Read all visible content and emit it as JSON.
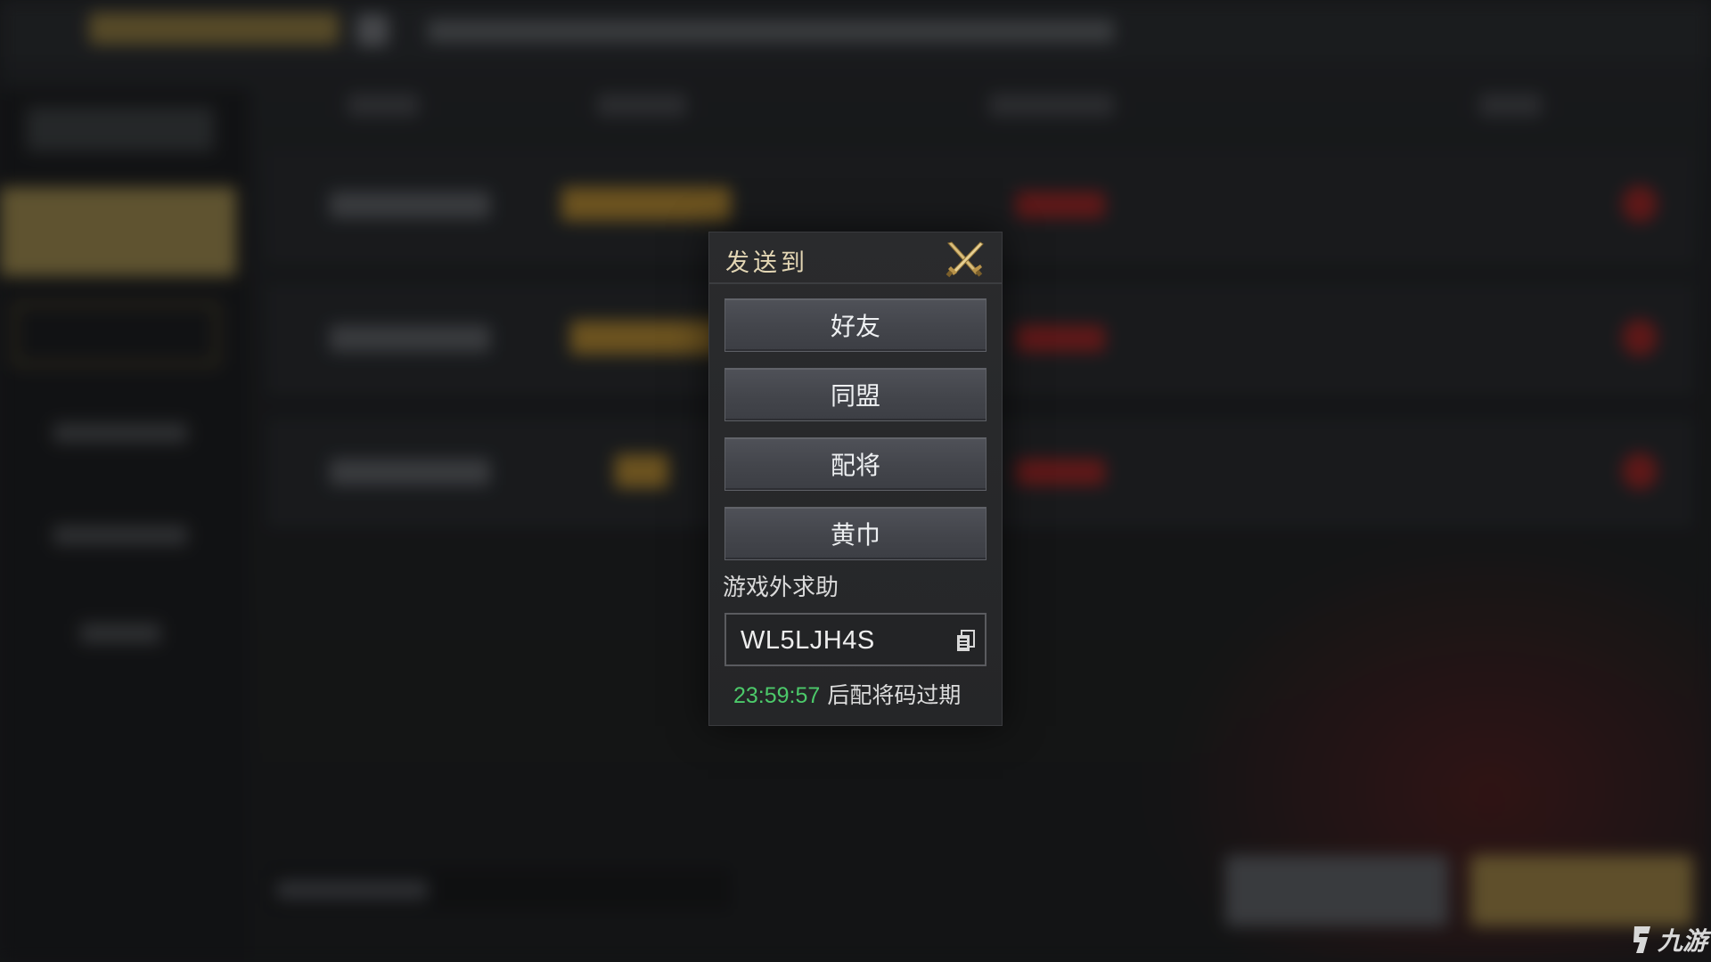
{
  "dialog": {
    "title": "发送到",
    "buttons": {
      "friend": "好友",
      "alliance": "同盟",
      "general": "配将",
      "yellow_turban": "黄巾"
    },
    "external_help_label": "游戏外求助",
    "code": "WL5LJH4S",
    "expire_time": "23:59:57",
    "expire_text": "后配将码过期"
  },
  "watermark": {
    "text": "九游"
  },
  "colors": {
    "title": "#e3d6b4",
    "countdown": "#4cc96a",
    "close_icon_gold": "#c9a55a"
  },
  "icons": {
    "close": "crossed-swords-close-icon",
    "copy": "copy-icon",
    "watermark_logo": "jiuyou-logo-icon"
  }
}
